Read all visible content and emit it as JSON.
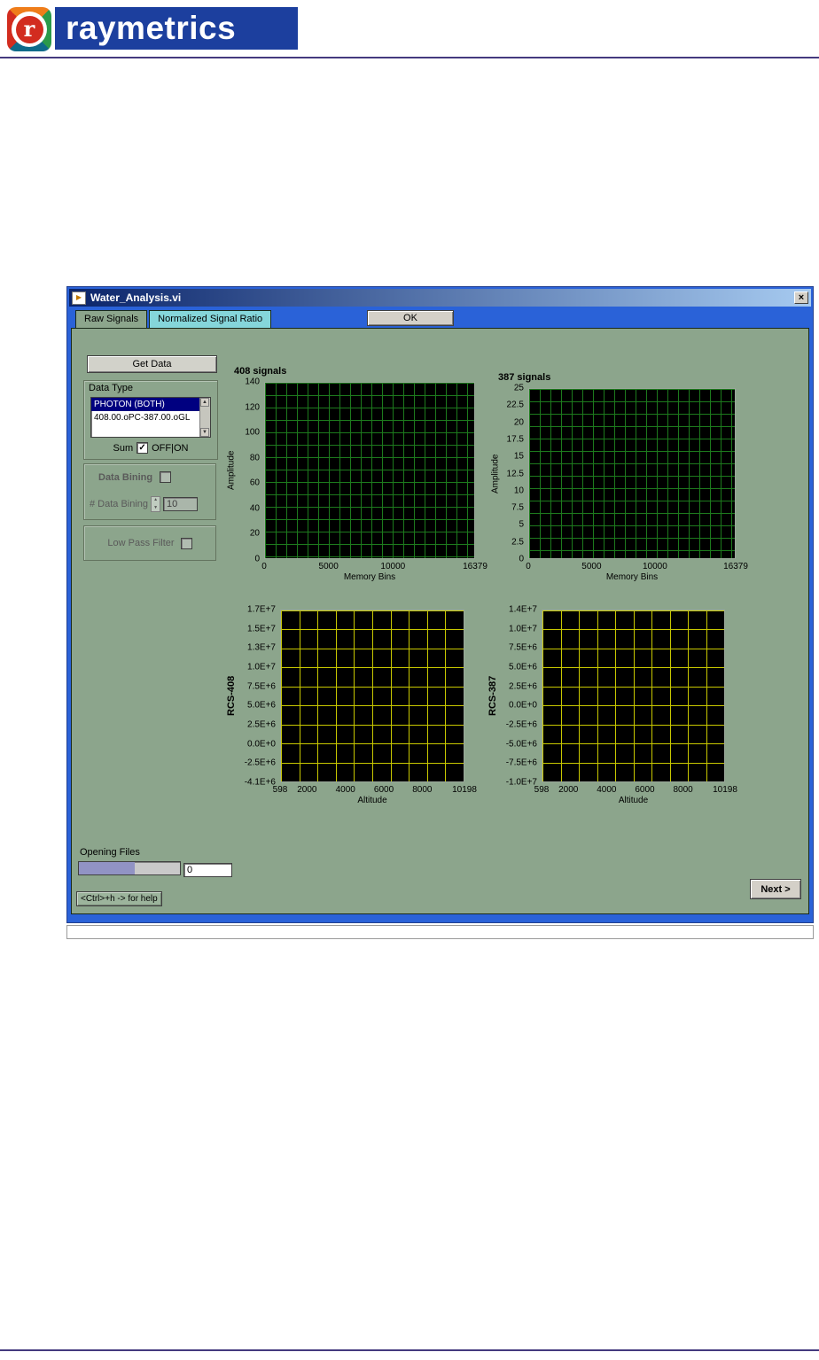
{
  "header": {
    "brand": "raymetrics",
    "logo_letter": "r"
  },
  "icons": {
    "vi": "▶",
    "check": "✓",
    "up": "▲",
    "down": "▼"
  },
  "colors": {
    "panel_green": "#8ca58c",
    "content_blue": "#2a62d8",
    "tab_inactive": "#85d6da",
    "selection_navy": "#000080",
    "plot_bg": "#000000"
  },
  "window": {
    "title": "Water_Analysis.vi",
    "close": "×",
    "tabs": [
      {
        "label": "Raw Signals",
        "active": true
      },
      {
        "label": "Normalized Signal Ratio",
        "active": false
      }
    ],
    "ok_button": "OK",
    "get_data_button": "Get Data",
    "data_type": {
      "label": "Data Type",
      "items": [
        {
          "text": "PHOTON (BOTH)",
          "selected": true
        },
        {
          "text": "408.00.oPC-387.00.oGL",
          "selected": false
        }
      ]
    },
    "sum": {
      "label": "Sum",
      "state": "OFF|ON",
      "checked": true
    },
    "binning": {
      "checkbox_label": "Data Bining",
      "count_label": "# Data Bining",
      "count_value": "10",
      "enabled": false
    },
    "low_pass": {
      "label": "Low Pass Filter",
      "enabled": false
    },
    "footer": {
      "opening_files": "Opening Files",
      "file_count": "0",
      "progress_fraction": 0.55,
      "help_button": "<Ctrl>+h -> for help",
      "next_button": "Next >"
    }
  },
  "chart_data": [
    {
      "type": "line",
      "title": "408 signals",
      "xlabel": "Memory Bins",
      "ylabel": "Amplitude",
      "xlim": [
        0,
        16379
      ],
      "ylim": [
        0,
        140
      ],
      "xticks": [
        "0",
        "5000",
        "10000",
        "16379"
      ],
      "yticks": [
        "140",
        "120",
        "100",
        "80",
        "60",
        "40",
        "20",
        "0"
      ],
      "grid": "dense",
      "grid_color": "#1d7a1d",
      "legend": "none",
      "series": []
    },
    {
      "type": "line",
      "title": "387 signals",
      "xlabel": "Memory Bins",
      "ylabel": "Amplitude",
      "xlim": [
        0,
        16379
      ],
      "ylim": [
        0,
        25
      ],
      "xticks": [
        "0",
        "5000",
        "10000",
        "16379"
      ],
      "yticks": [
        "25",
        "22.5",
        "20",
        "17.5",
        "15",
        "12.5",
        "10",
        "7.5",
        "5",
        "2.5",
        "0"
      ],
      "grid": "dense",
      "grid_color": "#1d7a1d",
      "legend": "none",
      "series": []
    },
    {
      "type": "line",
      "title": "",
      "xlabel": "Altitude",
      "ylabel": "RCS-408",
      "xlim": [
        598,
        10198
      ],
      "ylim": [
        -4100000,
        17000000
      ],
      "xticks": [
        "598",
        "2000",
        "4000",
        "6000",
        "8000",
        "10198"
      ],
      "yticks": [
        "1.7E+7",
        "1.5E+7",
        "1.3E+7",
        "1.0E+7",
        "7.5E+6",
        "5.0E+6",
        "2.5E+6",
        "0.0E+0",
        "-2.5E+6",
        "-4.1E+6"
      ],
      "grid": "major",
      "grid_color": "#c8c800",
      "legend": "none",
      "series": []
    },
    {
      "type": "line",
      "title": "",
      "xlabel": "Altitude",
      "ylabel": "RCS-387",
      "xlim": [
        598,
        10198
      ],
      "ylim": [
        -10000000,
        14000000
      ],
      "xticks": [
        "598",
        "2000",
        "4000",
        "6000",
        "8000",
        "10198"
      ],
      "yticks": [
        "1.4E+7",
        "1.0E+7",
        "7.5E+6",
        "5.0E+6",
        "2.5E+6",
        "0.0E+0",
        "-2.5E+6",
        "-5.0E+6",
        "-7.5E+6",
        "-1.0E+7"
      ],
      "grid": "major",
      "grid_color": "#c8c800",
      "legend": "none",
      "series": []
    }
  ]
}
